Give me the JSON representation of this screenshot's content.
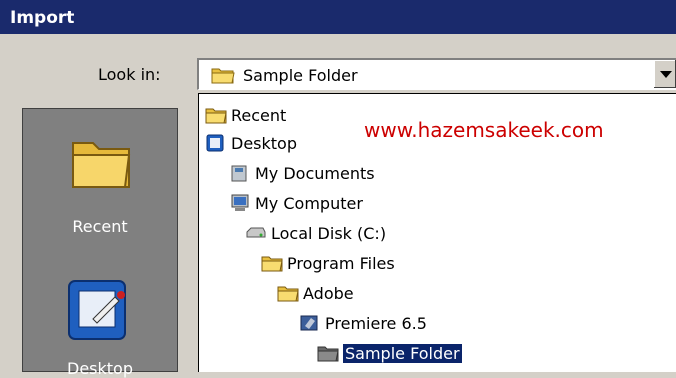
{
  "window": {
    "title": "Import"
  },
  "look_in": {
    "label": "Look in:",
    "value": "Sample Folder"
  },
  "places": [
    {
      "label": "Recent",
      "icon": "folder-icon"
    },
    {
      "label": "Desktop",
      "icon": "desktop-icon"
    }
  ],
  "dropdown_items": [
    {
      "label": "Recent",
      "icon": "folder-icon",
      "level": 0
    },
    {
      "label": "Desktop",
      "icon": "desktop-icon",
      "level": 0
    },
    {
      "label": "My Documents",
      "icon": "documents-icon",
      "level": 1
    },
    {
      "label": "My Computer",
      "icon": "computer-icon",
      "level": 1
    },
    {
      "label": "Local Disk (C:)",
      "icon": "disk-icon",
      "level": 2
    },
    {
      "label": "Program Files",
      "icon": "folder-icon",
      "level": 3
    },
    {
      "label": "Adobe",
      "icon": "folder-icon",
      "level": 4
    },
    {
      "label": "Premiere 6.5",
      "icon": "premiere-icon",
      "level": 5
    },
    {
      "label": "Sample Folder",
      "icon": "folder-open-icon",
      "level": 6,
      "selected": true
    }
  ],
  "watermark": "www.hazemsakeek.com",
  "colors": {
    "titlebar": "#1a2a6c",
    "selection": "#0a246a",
    "watermark": "#cc0000",
    "panel": "#d4d0c8"
  }
}
